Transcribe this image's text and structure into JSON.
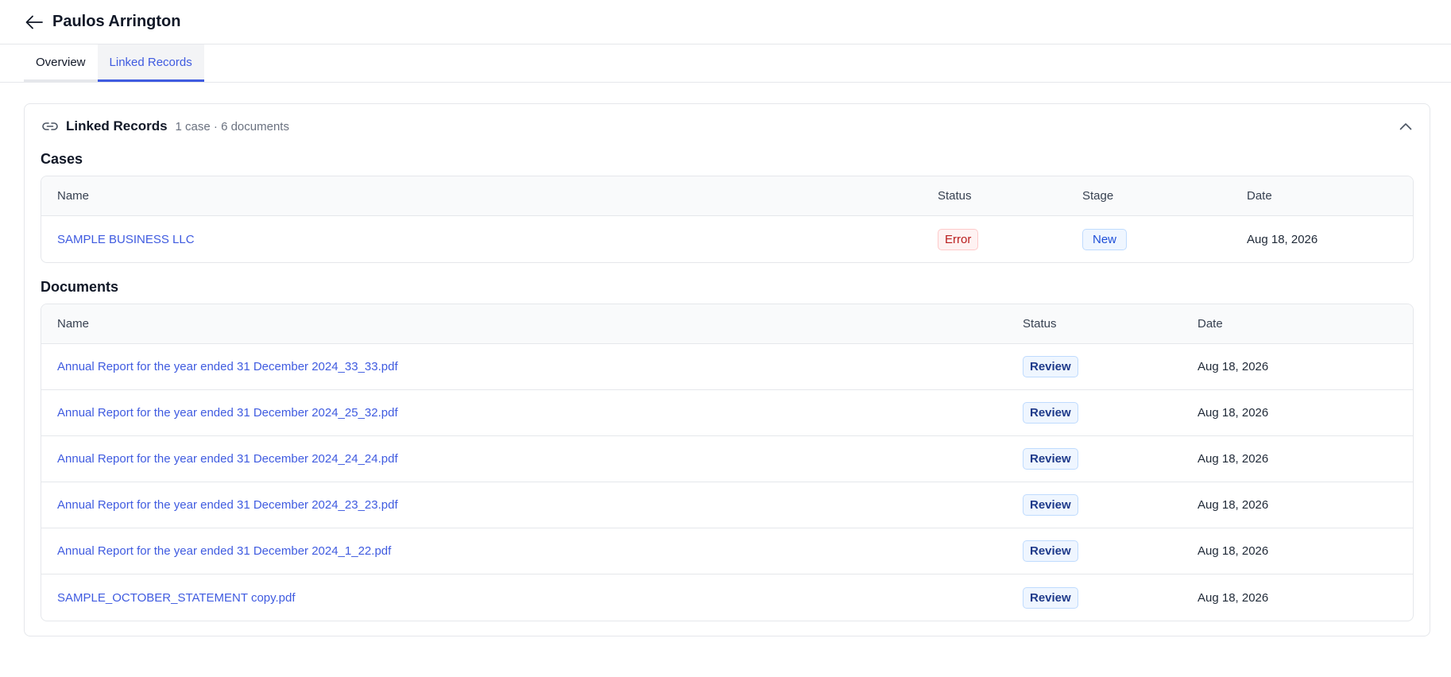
{
  "header": {
    "title": "Paulos Arrington",
    "back_icon": "arrow-left-icon"
  },
  "tabs": [
    {
      "label": "Overview",
      "active": false
    },
    {
      "label": "Linked Records",
      "active": true
    }
  ],
  "linked_records": {
    "title": "Linked Records",
    "subtitle": "1 case · 6 documents",
    "icon": "link-icon",
    "collapse_icon": "chevron-up-icon"
  },
  "cases": {
    "title": "Cases",
    "columns": {
      "name": "Name",
      "status": "Status",
      "stage": "Stage",
      "date": "Date"
    },
    "rows": [
      {
        "name": "SAMPLE BUSINESS LLC",
        "status": "Error",
        "stage": "New",
        "date": "Aug 18, 2026"
      }
    ]
  },
  "documents": {
    "title": "Documents",
    "columns": {
      "name": "Name",
      "status": "Status",
      "date": "Date"
    },
    "rows": [
      {
        "name": "Annual Report for the year ended 31 December 2024_33_33.pdf",
        "status": "Review",
        "date": "Aug 18, 2026"
      },
      {
        "name": "Annual Report for the year ended 31 December 2024_25_32.pdf",
        "status": "Review",
        "date": "Aug 18, 2026"
      },
      {
        "name": "Annual Report for the year ended 31 December 2024_24_24.pdf",
        "status": "Review",
        "date": "Aug 18, 2026"
      },
      {
        "name": "Annual Report for the year ended 31 December 2024_23_23.pdf",
        "status": "Review",
        "date": "Aug 18, 2026"
      },
      {
        "name": "Annual Report for the year ended 31 December 2024_1_22.pdf",
        "status": "Review",
        "date": "Aug 18, 2026"
      },
      {
        "name": "SAMPLE_OCTOBER_STATEMENT copy.pdf",
        "status": "Review",
        "date": "Aug 18, 2026"
      }
    ]
  },
  "colors": {
    "accent": "#3f5be0",
    "error": "#b91c1c",
    "border": "#e5e7eb"
  }
}
